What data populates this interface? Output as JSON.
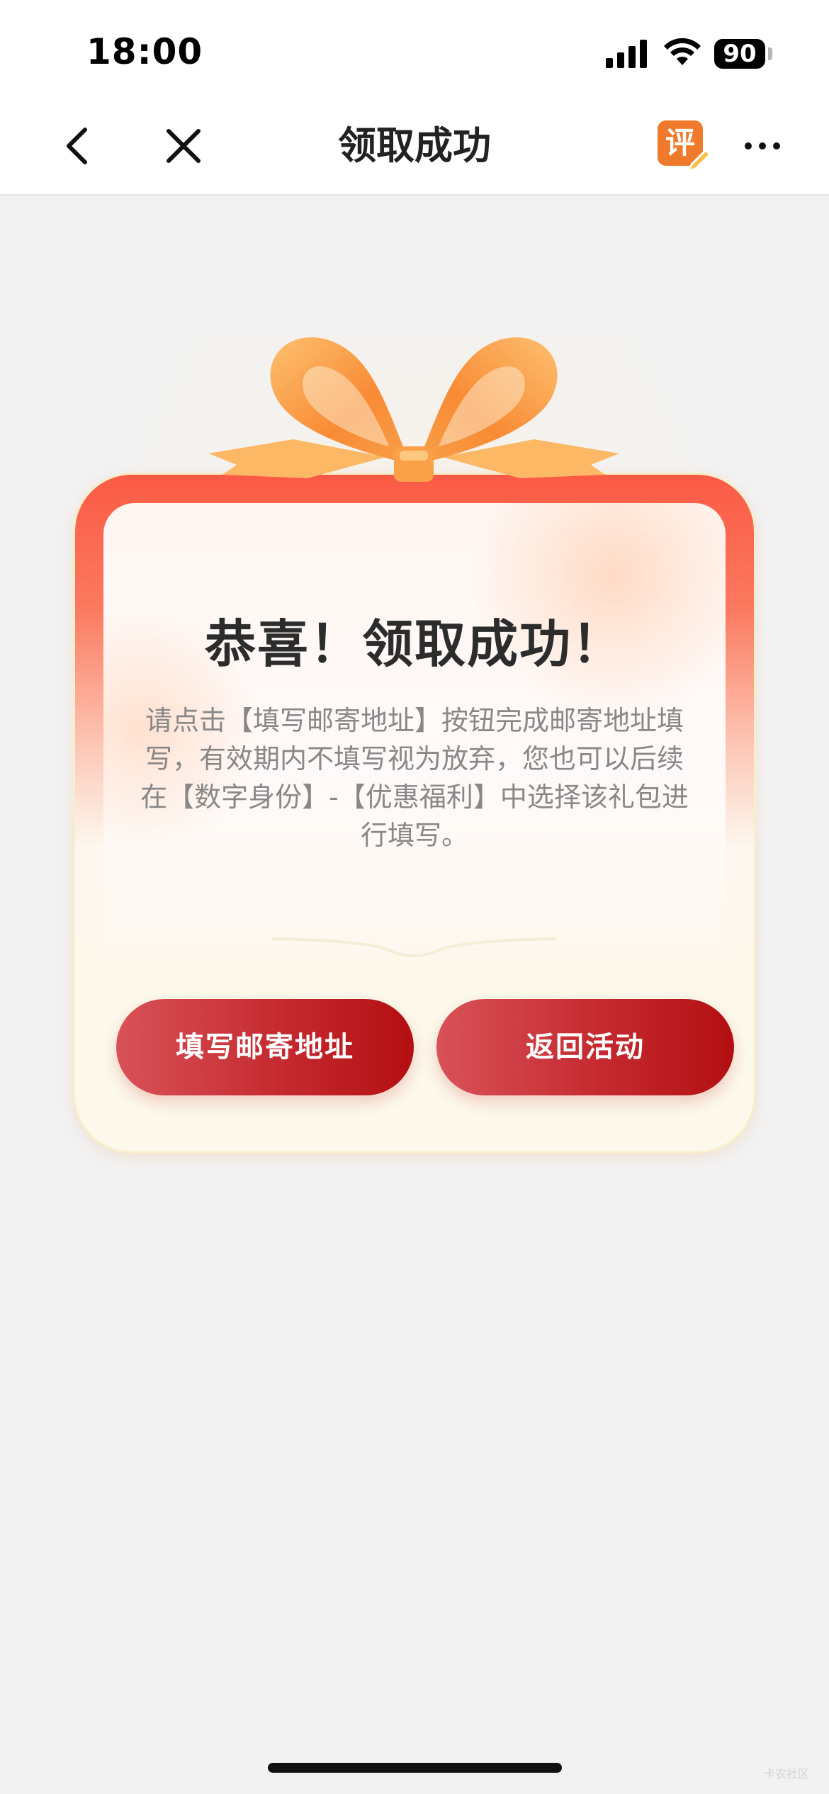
{
  "status_bar": {
    "time": "18:00",
    "battery_level": "90"
  },
  "nav": {
    "title": "领取成功",
    "review_badge": "评",
    "icons": [
      "back-arrow-icon",
      "close-icon",
      "review-icon",
      "more-icon"
    ]
  },
  "card": {
    "heading": "恭喜！领取成功！",
    "message": "请点击【填写邮寄地址】按钮完成邮寄地址填写，有效期内不填写视为放弃，您也可以后续在【数字身份】-【优惠福利】中选择该礼包进行填写。",
    "buttons": {
      "fill_address": "填写邮寄地址",
      "return_activity": "返回活动"
    }
  },
  "colors": {
    "accent_red": "#c52a30",
    "frame_red": "#fb5a45",
    "ribbon_orange": "#f98a34",
    "background": "#f2f2f2"
  },
  "watermark": "卡农社区"
}
